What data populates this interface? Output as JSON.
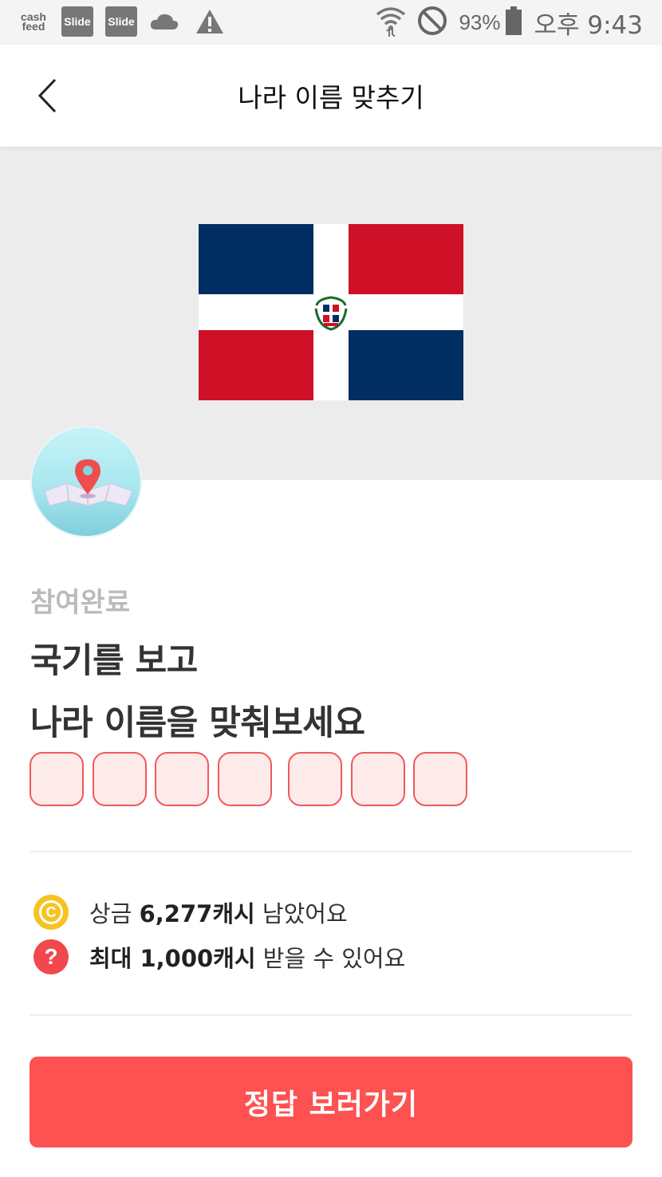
{
  "status_bar": {
    "cashfeed_line1": "cash",
    "cashfeed_line2": "feed",
    "slide_badge_1": "Slide",
    "slide_badge_2": "Slide",
    "battery_percent": "93%",
    "time": "오후 9:43",
    "icons": [
      "cloud-icon",
      "warning-icon",
      "wifi-icon",
      "do-not-disturb-icon",
      "battery-icon"
    ]
  },
  "header": {
    "title": "나라 이름 맞추기",
    "back_icon": "chevron-left-icon"
  },
  "quiz": {
    "flag_country_icon": "dominican-republic-flag",
    "status": "참여완료",
    "question_line1": "국기를 보고",
    "question_line2": "나라 이름을 맞춰보세요",
    "answer_boxes_word1": 4,
    "answer_boxes_word2": 3
  },
  "info": {
    "prize_prefix": "상금 ",
    "prize_amount": "6,277캐시",
    "prize_suffix": " 남았어요",
    "max_prefix": "최대 1,000캐시",
    "max_suffix": " 받을 수 있어요",
    "coin_icon_letter": "C",
    "help_icon_letter": "?"
  },
  "cta": {
    "label": "정답 보러가기"
  },
  "colors": {
    "accent": "#fe5151",
    "flag_blue": "#002d62",
    "flag_red": "#ce1126",
    "coin": "#f7c322"
  }
}
